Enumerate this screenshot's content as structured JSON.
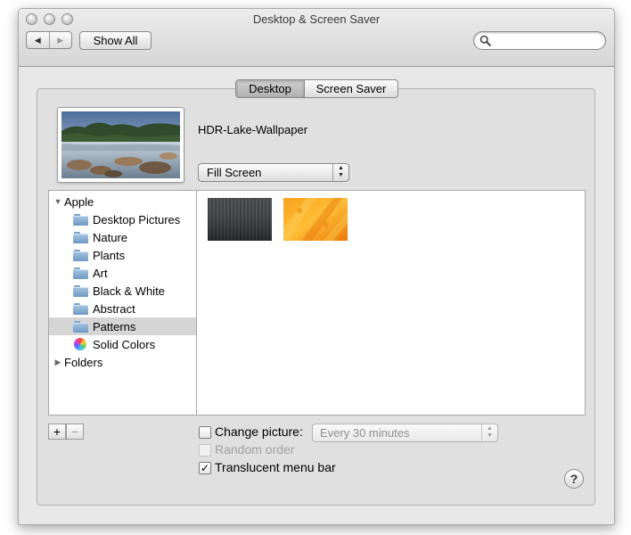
{
  "window": {
    "title": "Desktop & Screen Saver",
    "buttons": [
      "close-button",
      "minimize-button",
      "zoom-button"
    ]
  },
  "toolbar": {
    "back_glyph": "◀",
    "forward_glyph": "▶",
    "show_all_label": "Show All",
    "search_value": "",
    "search_placeholder": ""
  },
  "tabs": [
    {
      "label": "Desktop",
      "selected": true
    },
    {
      "label": "Screen Saver",
      "selected": false
    }
  ],
  "current": {
    "wallpaper_name": "HDR-Lake-Wallpaper",
    "fit_option": "Fill Screen"
  },
  "sidebar": {
    "items": [
      {
        "label": "Apple",
        "kind": "group-expanded",
        "icon": "disclosure-down-icon"
      },
      {
        "label": "Desktop Pictures",
        "kind": "folder",
        "icon": "folder-icon"
      },
      {
        "label": "Nature",
        "kind": "folder",
        "icon": "folder-icon"
      },
      {
        "label": "Plants",
        "kind": "folder",
        "icon": "folder-icon"
      },
      {
        "label": "Art",
        "kind": "folder",
        "icon": "folder-icon"
      },
      {
        "label": "Black & White",
        "kind": "folder",
        "icon": "folder-icon"
      },
      {
        "label": "Abstract",
        "kind": "folder",
        "icon": "folder-icon"
      },
      {
        "label": "Patterns",
        "kind": "folder",
        "icon": "folder-icon",
        "selected": true
      },
      {
        "label": "Solid Colors",
        "kind": "colors",
        "icon": "color-wheel-icon"
      },
      {
        "label": "Folders",
        "kind": "group-collapsed",
        "icon": "disclosure-right-icon"
      }
    ],
    "add_label": "+",
    "remove_label": "−"
  },
  "patterns": [
    {
      "name": "dark-stripes-pattern",
      "colors": [
        "#2a2c2e",
        "#4a4d50"
      ]
    },
    {
      "name": "orange-pattern",
      "colors": [
        "#f08a10",
        "#ffb530"
      ]
    }
  ],
  "options": {
    "change_picture": {
      "label": "Change picture:",
      "checked": false
    },
    "interval": "Every 30 minutes",
    "random_order": {
      "label": "Random order",
      "checked": false,
      "disabled": true
    },
    "translucent_menu_bar": {
      "label": "Translucent menu bar",
      "checked": true
    },
    "checkmark": "✓"
  },
  "help_label": "?"
}
